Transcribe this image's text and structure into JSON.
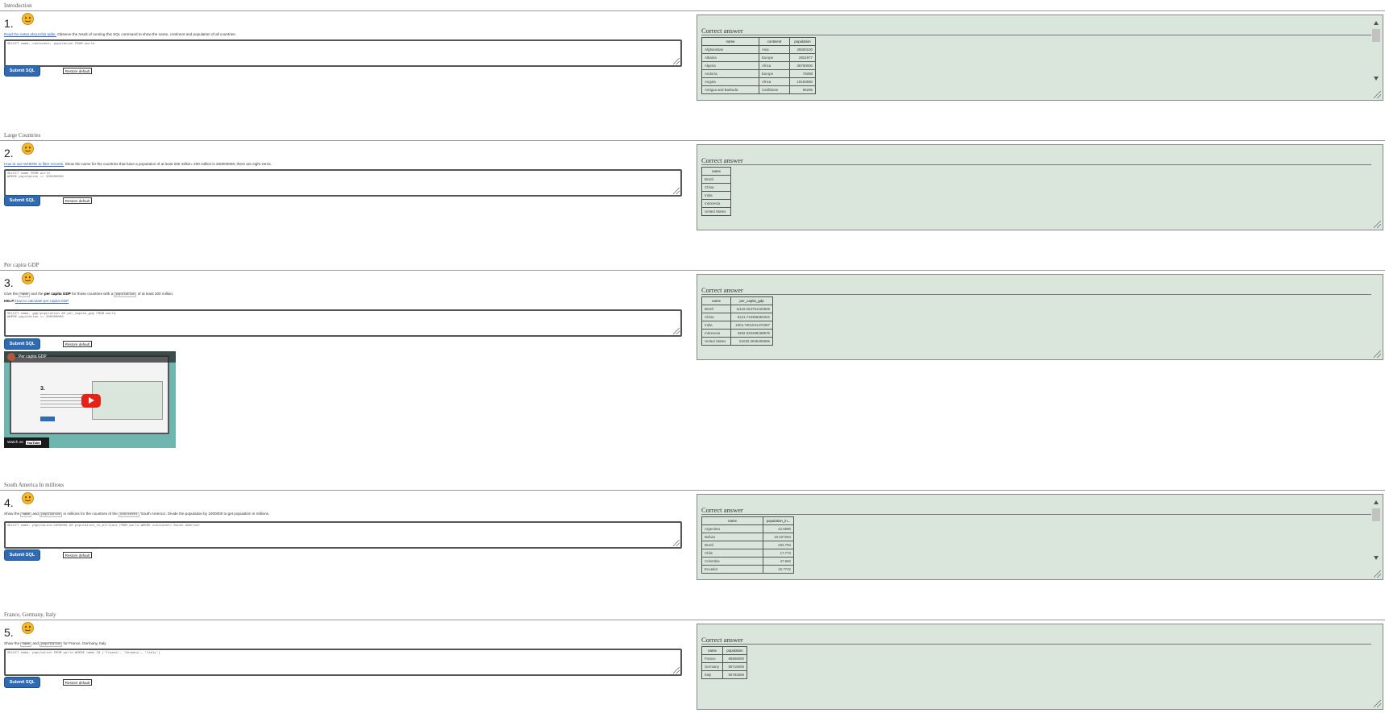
{
  "sections": [
    {
      "title": "Introduction",
      "num": "1.",
      "desc_link": "Read the notes about this table.",
      "desc_rest": " Observe the result of running this SQL command to show the name, continent and population of all countries.",
      "sql": "SELECT name, continent, population FROM world",
      "submit": "Submit SQL",
      "restore": "Restore default",
      "answer_title": "Correct answer",
      "answer_headers": [
        "name",
        "continent",
        "population"
      ],
      "answer_rows": [
        [
          "Afghanistan",
          "Asia",
          "25500100"
        ],
        [
          "Albania",
          "Europe",
          "2821977"
        ],
        [
          "Algeria",
          "Africa",
          "38700000"
        ],
        [
          "Andorra",
          "Europe",
          "76098"
        ],
        [
          "Angola",
          "Africa",
          "19183590"
        ],
        [
          "Antigua and Barbuda",
          "Caribbean",
          "86295"
        ]
      ]
    },
    {
      "title": "Large Countries",
      "num": "2.",
      "desc_link": "How to use WHERE to filter records.",
      "desc_rest": " Show the name for the countries that have a population of at least 200 million. 200 million is 200000000, there are eight zeros.",
      "sql": "SELECT name FROM world\nWHERE population >= 200000000",
      "submit": "Submit SQL",
      "restore": "Restore default",
      "answer_title": "Correct answer",
      "answer_headers": [
        "name"
      ],
      "answer_rows": [
        [
          "Brazil"
        ],
        [
          "China"
        ],
        [
          "India"
        ],
        [
          "Indonesia"
        ],
        [
          "United States"
        ]
      ]
    },
    {
      "title": "Per capita GDP",
      "num": "3.",
      "desc_a": "Give the ",
      "desc_code1": "name",
      "desc_b": " and the ",
      "desc_bold": "per capita GDP",
      "desc_c": " for those countries with a ",
      "desc_code2": "population",
      "desc_d": " of at least 200 million.",
      "help_bold": "HELP:",
      "help_rest": "How to calculate per capita GDP",
      "sql": "SELECT name, gdp/population AS per_capita_gdp FROM world\nWHERE population >= 200000000",
      "submit": "Submit SQL",
      "restore": "Restore default",
      "video_title": "Per capita GDP",
      "video_watch": "Watch on",
      "video_brand": "YouTube",
      "answer_title": "Correct answer",
      "answer_headers": [
        "name",
        "per_capita_gdp"
      ],
      "answer_rows": [
        [
          "Brazil",
          "11115.264751422825"
        ],
        [
          "China",
          "6121.710356050322"
        ],
        [
          "India",
          "1504.7501041476387"
        ],
        [
          "Indonesia",
          "3482.020498188876"
        ],
        [
          "United States",
          "51032.2945406806"
        ]
      ]
    },
    {
      "title": "South America In millions",
      "num": "4.",
      "desc_a": "Show the ",
      "desc_code1": "name",
      "desc_b": " and ",
      "desc_code2": "population",
      "desc_c": " in millions for the countries of the ",
      "desc_code3": "continent",
      "desc_d": " 'South America'. Divide the population by 1000000 to get population in millions.",
      "sql": "SELECT name, population/1000000 AS population_in_millions FROM world WHERE continent='South America'",
      "submit": "Submit SQL",
      "restore": "Restore default",
      "answer_title": "Correct answer",
      "answer_headers": [
        "name",
        "population_in..."
      ],
      "answer_rows": [
        [
          "Argentina",
          "42.6690"
        ],
        [
          "Bolivia",
          "10.027254"
        ],
        [
          "Brazil",
          "202.794"
        ],
        [
          "Chile",
          "17.773"
        ],
        [
          "Colombia",
          "47.662"
        ],
        [
          "Ecuador",
          "15.7742"
        ]
      ]
    },
    {
      "title": "France, Germany, Italy",
      "num": "5.",
      "desc_a": "Show the ",
      "desc_code1": "name",
      "desc_b": " and ",
      "desc_code2": "population",
      "desc_c": " for France, Germany, Italy",
      "sql": "SELECT name, population FROM world WHERE name IN ('France', 'Germany', 'Italy')",
      "submit": "Submit SQL",
      "restore": "Restore default",
      "answer_title": "Correct answer",
      "answer_headers": [
        "name",
        "population"
      ],
      "answer_rows": [
        [
          "France",
          "65906000"
        ],
        [
          "Germany",
          "80716000"
        ],
        [
          "Italy",
          "60782668"
        ]
      ]
    }
  ]
}
